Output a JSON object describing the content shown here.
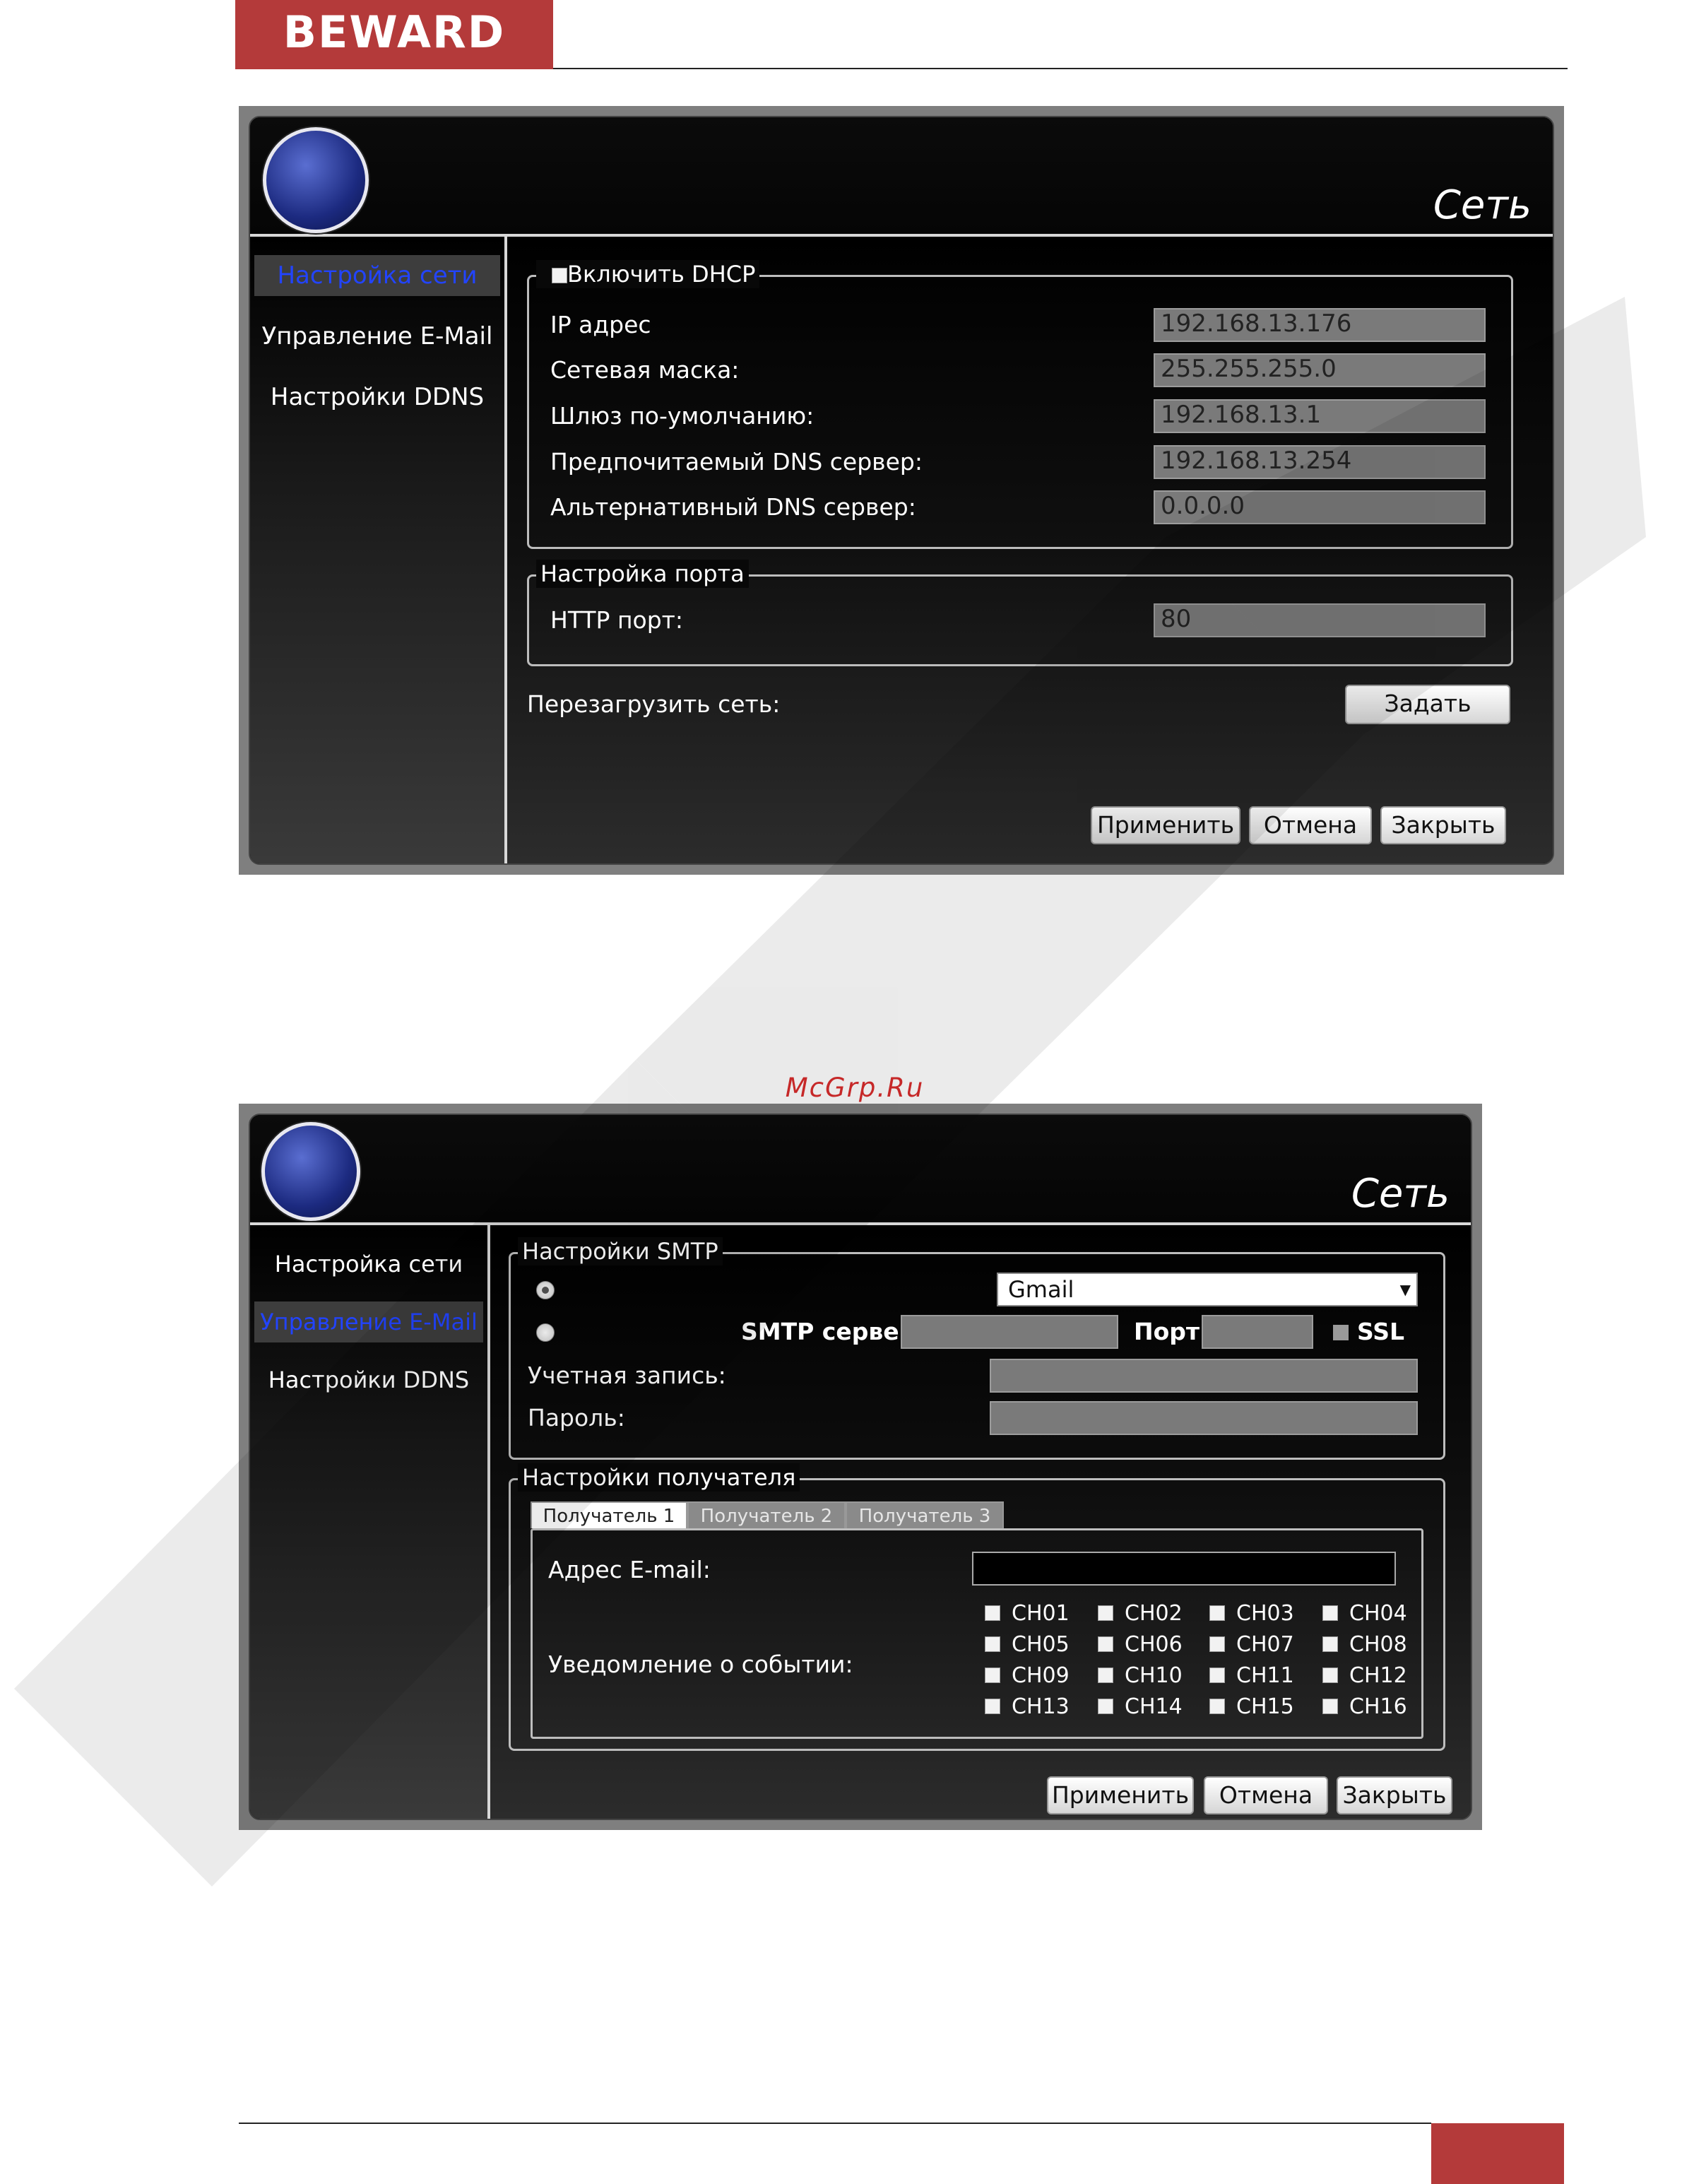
{
  "brand": {
    "logo_text": "BEWARD",
    "accent_color": "#b43a3a"
  },
  "watermark_text": "McGrp.Ru",
  "network_dialog": {
    "title": "Сеть",
    "sidebar": [
      {
        "label": "Настройка сети",
        "active": true
      },
      {
        "label": "Управление E-Mail",
        "active": false
      },
      {
        "label": "Настройки DDNS",
        "active": false
      }
    ],
    "dhcp_label": "Включить DHCP",
    "ip_label": "IP адрес",
    "ip_value": "192.168.13.176",
    "mask_label": "Сетевая маска:",
    "mask_value": "255.255.255.0",
    "gateway_label": "Шлюз по-умолчанию:",
    "gateway_value": "192.168.13.1",
    "dns1_label": "Предпочитаемый DNS сервер:",
    "dns1_value": "192.168.13.254",
    "dns2_label": "Альтернативный DNS сервер:",
    "dns2_value": "0.0.0.0",
    "port_group": "Настройка порта",
    "http_label": "HTTP порт:",
    "http_value": "80",
    "restart_label": "Перезагрузить сеть:",
    "set_button": "Задать",
    "apply": "Применить",
    "cancel": "Отмена",
    "close": "Закрыть"
  },
  "email_dialog": {
    "title": "Сеть",
    "sidebar": [
      {
        "label": "Настройка сети",
        "active": false
      },
      {
        "label": "Управление E-Mail",
        "active": true
      },
      {
        "label": "Настройки DDNS",
        "active": false
      }
    ],
    "smtp_group": "Настройки SMTP",
    "provider_selected": "Gmail",
    "smtp_server_label": "SMTP сервер:",
    "port_label": "Порт:",
    "ssl_label": "SSL",
    "account_label": "Учетная запись:",
    "password_label": "Пароль:",
    "recipient_group": "Настройки получателя",
    "tabs": [
      "Получатель 1",
      "Получатель 2",
      "Получатель 3"
    ],
    "email_label": "Адрес E-mail:",
    "notify_label": "Уведомление о событии:",
    "channels": [
      "CH01",
      "CH02",
      "CH03",
      "CH04",
      "CH05",
      "CH06",
      "CH07",
      "CH08",
      "CH09",
      "CH10",
      "CH11",
      "CH12",
      "CH13",
      "CH14",
      "CH15",
      "CH16"
    ],
    "apply": "Применить",
    "cancel": "Отмена",
    "close": "Закрыть"
  }
}
